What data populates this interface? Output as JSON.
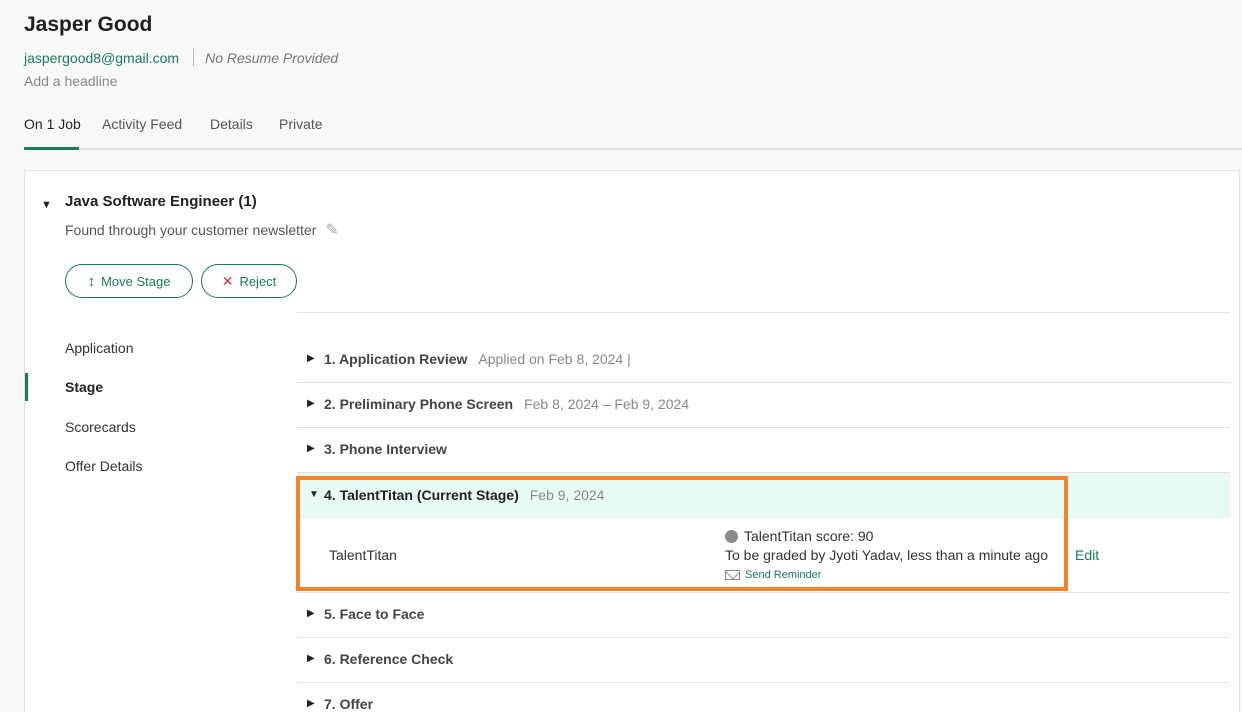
{
  "candidate": {
    "name": "Jasper Good",
    "email": "jaspergood8@gmail.com",
    "resume_status": "No Resume Provided",
    "headline_placeholder": "Add a headline"
  },
  "tabs": [
    {
      "label": "On 1 Job",
      "active": true
    },
    {
      "label": "Activity Feed",
      "active": false
    },
    {
      "label": "Details",
      "active": false
    },
    {
      "label": "Private",
      "active": false
    }
  ],
  "job": {
    "title": "Java Software Engineer (1)",
    "source": "Found through your customer newsletter",
    "move_stage_label": "Move Stage",
    "reject_label": "Reject"
  },
  "subnav": [
    {
      "label": "Application",
      "active": false
    },
    {
      "label": "Stage",
      "active": true
    },
    {
      "label": "Scorecards",
      "active": false
    },
    {
      "label": "Offer Details",
      "active": false
    }
  ],
  "stages": [
    {
      "label": "1.  Application Review",
      "meta": "Applied on Feb 8, 2024 |"
    },
    {
      "label": "2.  Preliminary Phone Screen",
      "meta": "Feb 8, 2024 – Feb 9, 2024"
    },
    {
      "label": "3.  Phone Interview",
      "meta": ""
    },
    {
      "label": "5.  Face to Face",
      "meta": ""
    },
    {
      "label": "6.  Reference Check",
      "meta": ""
    },
    {
      "label": "7.  Offer",
      "meta": ""
    }
  ],
  "current_stage": {
    "label": "4.  TalentTitan (Current Stage)",
    "meta": "Feb 9, 2024",
    "interview_name": "TalentTitan",
    "score_text": "TalentTitan score: 90",
    "graded_text": "To be graded by Jyoti Yadav, less than a minute ago",
    "reminder_label": "Send Reminder",
    "edit_label": "Edit"
  },
  "colors": {
    "accent": "#1a7a5e",
    "highlight": "#f5832a",
    "current_stage_bg": "#e8faf4",
    "reject_icon": "#d9363e"
  },
  "icons": [
    "move-stage-icon",
    "reject-x-icon",
    "pencil-icon",
    "mail-icon",
    "collapse-arrow-icon",
    "expand-arrow-icon"
  ]
}
